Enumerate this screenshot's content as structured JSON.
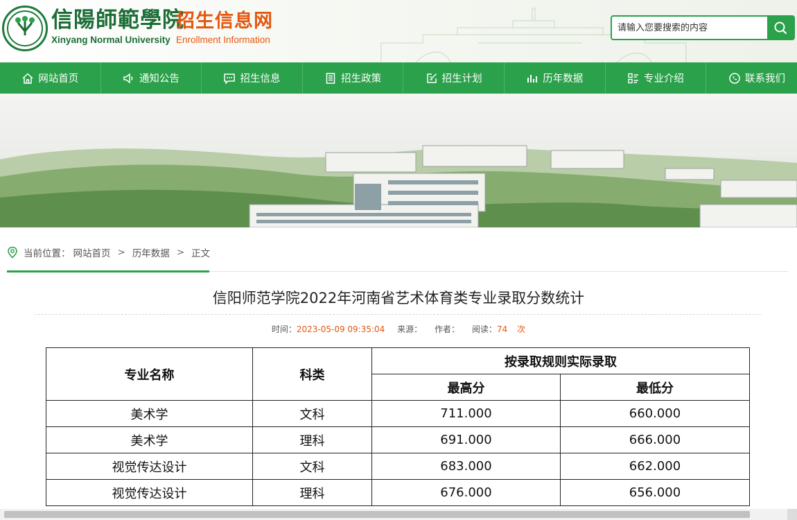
{
  "header": {
    "logo_cn": "信陽師範學院",
    "logo_en": "Xinyang Normal University",
    "site_cn": "招生信息网",
    "site_en": "Enrollment Information",
    "search_placeholder": "请输入您要搜索的内容"
  },
  "nav": [
    {
      "label": "网站首页",
      "icon": "home-icon"
    },
    {
      "label": "通知公告",
      "icon": "speaker-icon"
    },
    {
      "label": "招生信息",
      "icon": "chat-icon"
    },
    {
      "label": "招生政策",
      "icon": "document-icon"
    },
    {
      "label": "招生计划",
      "icon": "edit-icon"
    },
    {
      "label": "历年数据",
      "icon": "bar-chart-icon"
    },
    {
      "label": "专业介绍",
      "icon": "list-icon"
    },
    {
      "label": "联系我们",
      "icon": "phone-icon"
    }
  ],
  "breadcrumb": {
    "prefix": "当前位置：",
    "items": [
      "网站首页",
      "历年数据",
      "正文"
    ],
    "separator": ">"
  },
  "article": {
    "title": "信阳师范学院2022年河南省艺术体育类专业录取分数统计",
    "time_label": "时间：",
    "time_value": "2023-05-09 09:35:04",
    "source_label": "来源：",
    "author_label": "作者：",
    "reads_label": "阅读：",
    "reads_value": "74",
    "reads_unit": "次"
  },
  "table": {
    "col_major": "专业名称",
    "col_subject": "科类",
    "group_header": "按录取规则实际录取",
    "col_max": "最高分",
    "col_min": "最低分",
    "rows": [
      [
        "美术学",
        "文科",
        "711.000",
        "660.000"
      ],
      [
        "美术学",
        "理科",
        "691.000",
        "666.000"
      ],
      [
        "视觉传达设计",
        "文科",
        "683.000",
        "662.000"
      ],
      [
        "视觉传达设计",
        "理科",
        "676.000",
        "656.000"
      ]
    ]
  },
  "colors": {
    "brand_green": "#2aa14a",
    "logo_green": "#1b6d36",
    "accent_orange": "#e4570f"
  }
}
